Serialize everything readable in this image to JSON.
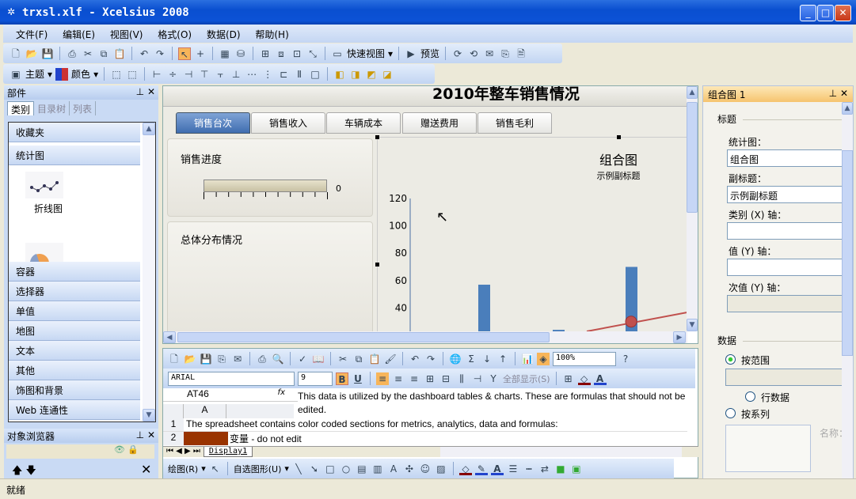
{
  "window": {
    "title": "trxsl.xlf - Xcelsius 2008",
    "min": "_",
    "max": "□",
    "close": "✕"
  },
  "menu": [
    "文件(F)",
    "编辑(E)",
    "视图(V)",
    "格式(O)",
    "数据(D)",
    "帮助(H)"
  ],
  "toolbar": {
    "quick_view": "快速视图",
    "preview": "预览",
    "theme": "主题",
    "color": "颜色"
  },
  "components": {
    "title": "部件",
    "tabs": [
      "类别",
      "目录树",
      "列表"
    ],
    "categories_top": [
      "收藏夹",
      "统计图"
    ],
    "chart_items": [
      "折线图"
    ],
    "categories_bottom": [
      "容器",
      "选择器",
      "单值",
      "地图",
      "文本",
      "其他",
      "饰图和背景",
      "Web 连通性"
    ]
  },
  "object_browser": {
    "title": "对象浏览器"
  },
  "dashboard": {
    "title": "2010年整车销售情况",
    "tabs": [
      "销售台次",
      "销售收入",
      "车辆成本",
      "赠送费用",
      "销售毛利"
    ],
    "active_tab": 0,
    "progress_panel": {
      "title": "销售进度",
      "value": "0",
      "fill": 0
    },
    "distribution_panel": {
      "title": "总体分布情况"
    }
  },
  "chart_data": {
    "type": "bar+line",
    "title": "组合图",
    "subtitle": "示例副标题",
    "y_ticks": [
      40,
      60,
      80,
      100,
      120
    ],
    "bars": [
      57,
      24,
      70
    ],
    "line_point": 30,
    "colors": {
      "bar": "#4a7ebb",
      "line": "#c0504d"
    }
  },
  "spreadsheet": {
    "zoom": "100%",
    "font": "ARIAL",
    "font_size": "9",
    "bold": "B",
    "underline": "U",
    "show_all": "全部显示(S)",
    "cell_ref": "AT46",
    "fx": "fx",
    "formula": "This data is utilized by the dashboard tables & charts.  These are formulas that should not be edited.",
    "col_header": "A",
    "rows": [
      {
        "num": "1",
        "text": "The spreadsheet contains color coded sections for metrics, analytics, data and formulas:"
      },
      {
        "num": "2",
        "text": "变量 - do not edit",
        "swatch": "#993300"
      }
    ],
    "sheet_tab": "Display1",
    "draw_label": "绘图(R)",
    "autoshape_label": "自选图形(U)"
  },
  "properties": {
    "title": "组合图 1",
    "section_title": "标题",
    "chart_label": "统计图：",
    "chart_value": "组合图",
    "subtitle_label": "副标题：",
    "subtitle_value": "示例副标题",
    "xaxis_label": "类别 (X) 轴：",
    "yaxis_label": "值 (Y) 轴：",
    "y2axis_label": "次值 (Y) 轴：",
    "data_section": "数据",
    "by_range": "按范围",
    "row_data": "行数据",
    "by_series": "按系列",
    "name_label": "名称："
  },
  "status": "就绪"
}
